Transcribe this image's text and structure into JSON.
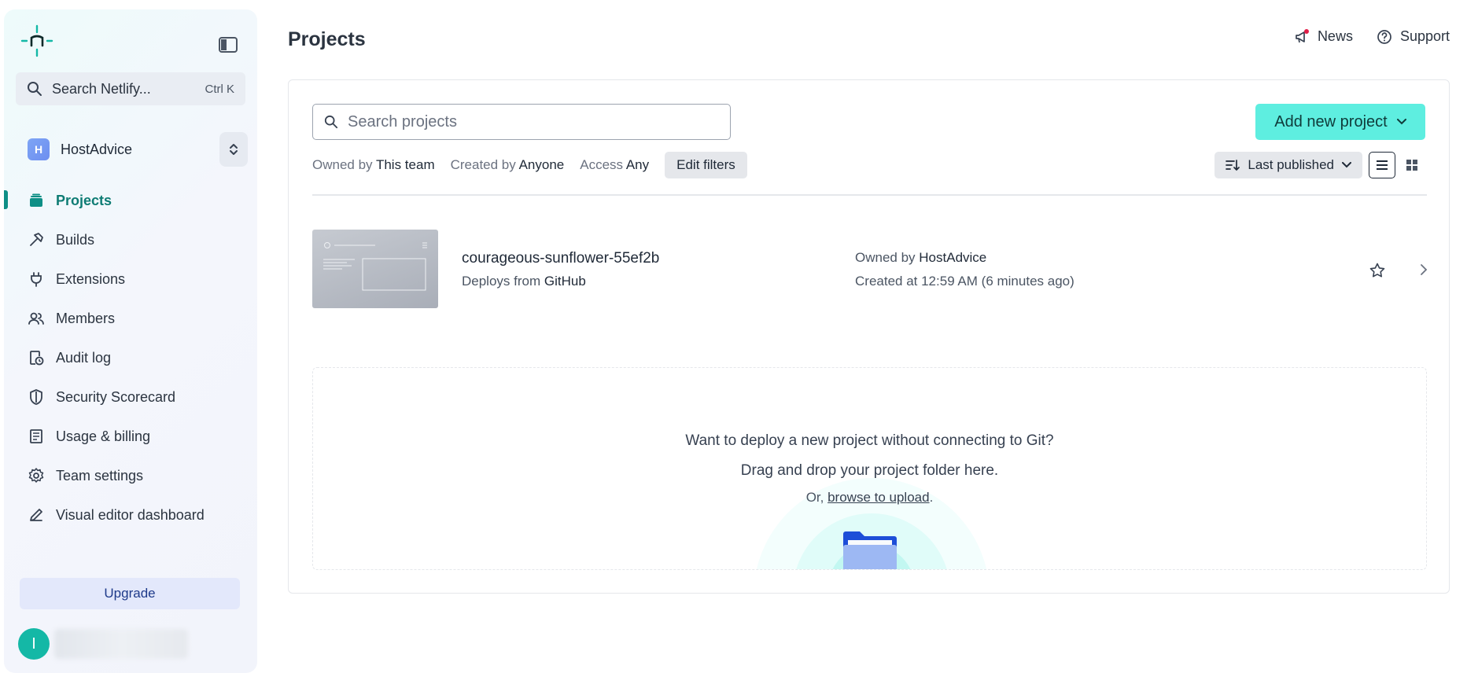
{
  "sidebar": {
    "search": {
      "label": "Search Netlify...",
      "shortcut": "Ctrl K"
    },
    "team": {
      "initial": "H",
      "name": "HostAdvice"
    },
    "items": [
      {
        "label": "Projects",
        "icon": "layers-icon",
        "active": true
      },
      {
        "label": "Builds",
        "icon": "hammer-icon"
      },
      {
        "label": "Extensions",
        "icon": "plug-icon"
      },
      {
        "label": "Members",
        "icon": "members-icon"
      },
      {
        "label": "Audit log",
        "icon": "audit-log-icon"
      },
      {
        "label": "Security Scorecard",
        "icon": "shield-icon"
      },
      {
        "label": "Usage & billing",
        "icon": "receipt-icon"
      },
      {
        "label": "Team settings",
        "icon": "gear-icon"
      },
      {
        "label": "Visual editor dashboard",
        "icon": "pencil-icon"
      }
    ],
    "upgrade_label": "Upgrade",
    "user_initial": "I"
  },
  "header": {
    "title": "Projects",
    "news_label": "News",
    "support_label": "Support"
  },
  "toolbar": {
    "search_placeholder": "Search projects",
    "add_button_label": "Add new project",
    "filters": {
      "owned_prefix": "Owned by",
      "owned_value": "This team",
      "created_prefix": "Created by",
      "created_value": "Anyone",
      "access_prefix": "Access",
      "access_value": "Any",
      "edit_label": "Edit filters"
    },
    "sort_label": "Last published"
  },
  "project": {
    "name": "courageous-sunflower-55ef2b",
    "deploys_prefix": "Deploys from",
    "deploys_source": "GitHub",
    "owner_prefix": "Owned by",
    "owner": "HostAdvice",
    "created": "Created at 12:59 AM (6 minutes ago)"
  },
  "dropzone": {
    "line1": "Want to deploy a new project without connecting to Git?",
    "line2": "Drag and drop your project folder here.",
    "line3_prefix": "Or, ",
    "line3_link": "browse to upload",
    "line3_suffix": "."
  },
  "colors": {
    "accent": "#5eeee0",
    "active_nav": "#0e7c74",
    "upgrade_bg": "#e3e8fb"
  }
}
